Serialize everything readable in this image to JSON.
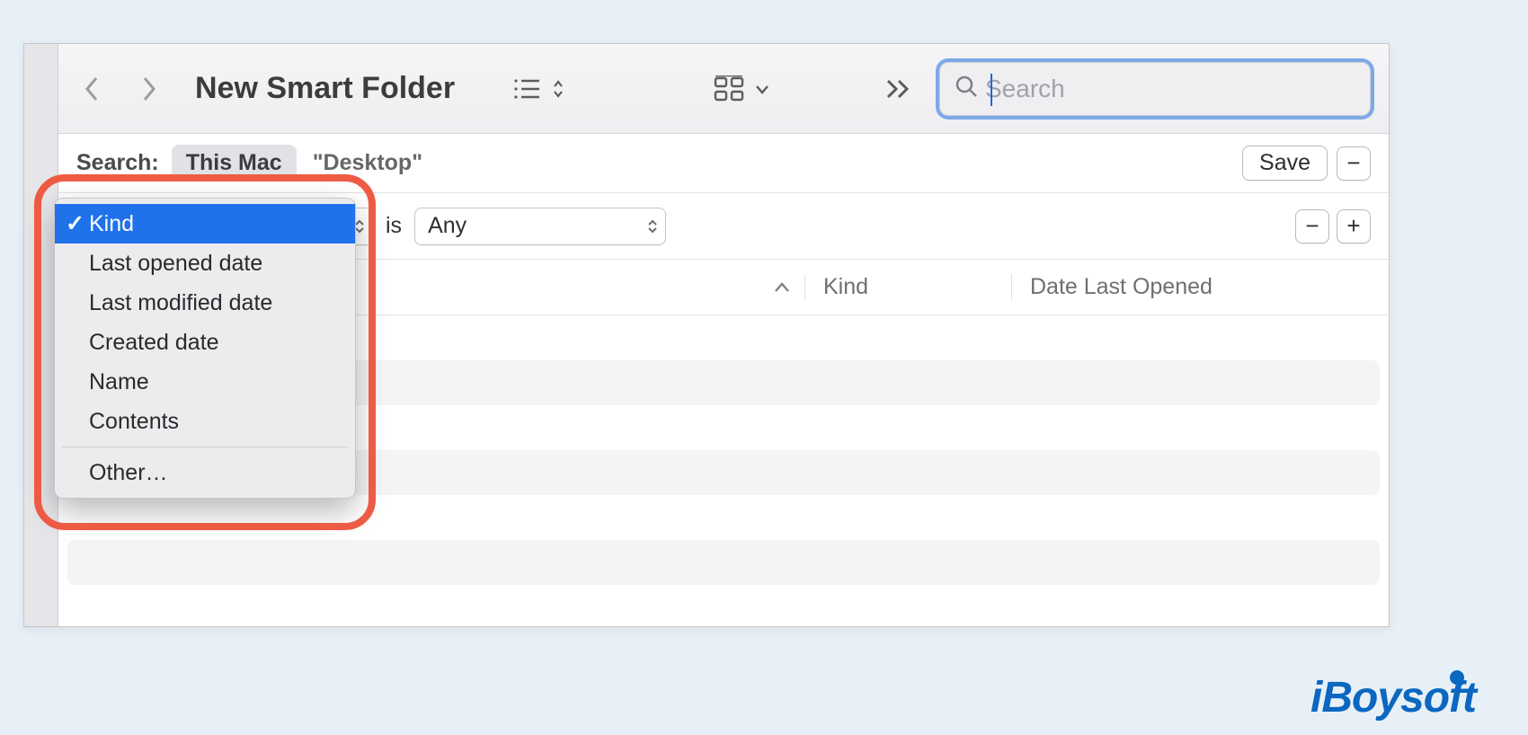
{
  "window": {
    "title": "New Smart Folder"
  },
  "search": {
    "placeholder": "Search",
    "value": ""
  },
  "scope": {
    "label": "Search:",
    "active": "This Mac",
    "option_quoted": "\"Desktop\"",
    "save_label": "Save"
  },
  "criteria": {
    "attribute_selected": "Kind",
    "operator": "is",
    "value_selected": "Any"
  },
  "columns": {
    "kind": "Kind",
    "date_opened": "Date Last Opened"
  },
  "dropdown": {
    "items": [
      "Kind",
      "Last opened date",
      "Last modified date",
      "Created date",
      "Name",
      "Contents"
    ],
    "other": "Other…",
    "selected_index": 0
  },
  "watermark": "iBoysoft"
}
